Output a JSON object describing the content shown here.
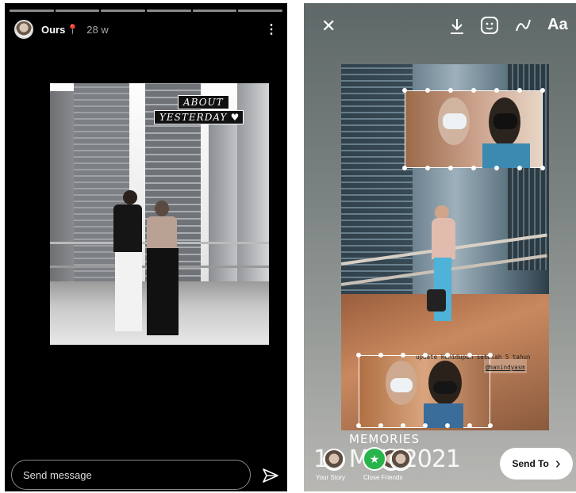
{
  "left": {
    "username": "Ours",
    "flag": "📍",
    "time": "28 w",
    "more": "⋮",
    "overlay_line1": "ABOUT",
    "overlay_line2": "YESTERDAY",
    "heart": "♥",
    "message_placeholder": "Send message",
    "story_segments": 6
  },
  "right": {
    "close": "✕",
    "text_tool": "Aa",
    "caption": "update kehidupan setelah 5 tahun",
    "mention": "@hanindyasm",
    "memories": "MEMORIES",
    "date": "10 MAY 2021",
    "your_story": "Your Story",
    "close_friends": "Close Friends",
    "send_to": "Send To",
    "chevron": "›"
  },
  "colors": {
    "close_friends_green": "#29b34b",
    "panel_bg": "#000000"
  }
}
